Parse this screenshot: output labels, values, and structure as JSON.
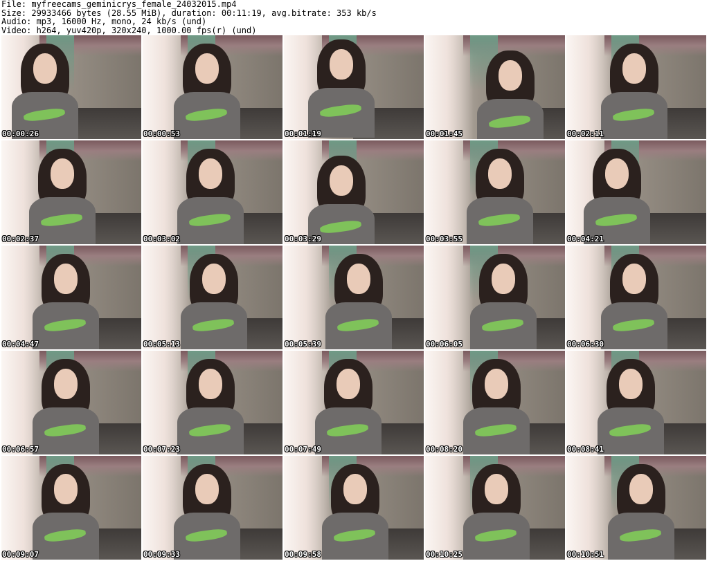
{
  "header": {
    "lines": [
      "File: myfreecams_geminicrys_female_24032015.mp4",
      "Size: 29933466 bytes (28.55 MiB), duration: 00:11:19, avg.bitrate: 353 kb/s",
      "Audio: mp3, 16000 Hz, mono, 24 kb/s (und)",
      "Video: h264, yuv420p, 320x240, 1000.00 fps(r) (und)"
    ]
  },
  "thumbnails": [
    {
      "timestamp": "00:00:26"
    },
    {
      "timestamp": "00:00:53"
    },
    {
      "timestamp": "00:01:19"
    },
    {
      "timestamp": "00:01:45"
    },
    {
      "timestamp": "00:02:11"
    },
    {
      "timestamp": "00:02:37"
    },
    {
      "timestamp": "00:03:02"
    },
    {
      "timestamp": "00:03:29"
    },
    {
      "timestamp": "00:03:55"
    },
    {
      "timestamp": "00:04:21"
    },
    {
      "timestamp": "00:04:47"
    },
    {
      "timestamp": "00:05:13"
    },
    {
      "timestamp": "00:05:39"
    },
    {
      "timestamp": "00:06:05"
    },
    {
      "timestamp": "00:06:30"
    },
    {
      "timestamp": "00:06:57"
    },
    {
      "timestamp": "00:07:23"
    },
    {
      "timestamp": "00:07:49"
    },
    {
      "timestamp": "00:08:20"
    },
    {
      "timestamp": "00:08:41"
    },
    {
      "timestamp": "00:09:07"
    },
    {
      "timestamp": "00:09:33"
    },
    {
      "timestamp": "00:09:58"
    },
    {
      "timestamp": "00:10:25"
    },
    {
      "timestamp": "00:10:51"
    }
  ]
}
